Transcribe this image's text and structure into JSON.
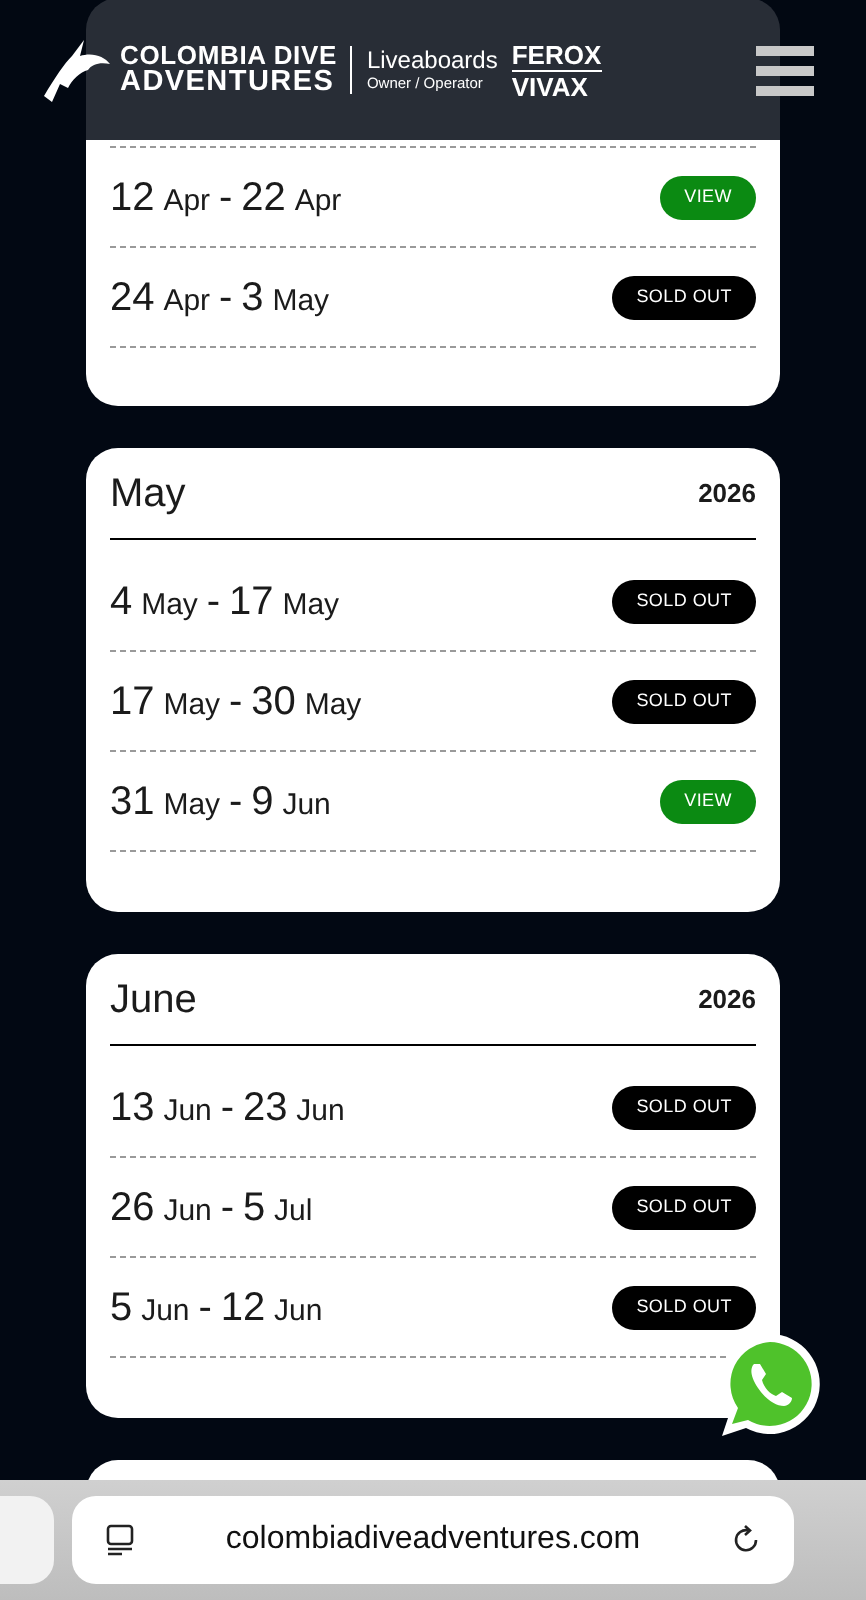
{
  "header": {
    "brand_line_1": "COLOMBIA DIVE",
    "brand_line_2": "ADVENTURES",
    "tagline_1": "Liveaboards",
    "tagline_2": "Owner / Operator",
    "boat_line_1": "FEROX",
    "boat_line_2": "VIVAX"
  },
  "months": [
    {
      "trips": [
        {
          "start_day": "12",
          "start_month": "Apr",
          "separator": "-",
          "end_day": "22",
          "end_month": "Apr",
          "status": {
            "kind": "view",
            "label": "VIEW"
          }
        },
        {
          "start_day": "24",
          "start_month": "Apr",
          "separator": "-",
          "end_day": "3",
          "end_month": "May",
          "status": {
            "kind": "sold_out",
            "label": "SOLD OUT"
          }
        }
      ]
    },
    {
      "name": "May",
      "year": "2026",
      "trips": [
        {
          "start_day": "4",
          "start_month": "May",
          "separator": "-",
          "end_day": "17",
          "end_month": "May",
          "status": {
            "kind": "sold_out",
            "label": "SOLD OUT"
          }
        },
        {
          "start_day": "17",
          "start_month": "May",
          "separator": "-",
          "end_day": "30",
          "end_month": "May",
          "status": {
            "kind": "sold_out",
            "label": "SOLD OUT"
          }
        },
        {
          "start_day": "31",
          "start_month": "May",
          "separator": "-",
          "end_day": "9",
          "end_month": "Jun",
          "status": {
            "kind": "view",
            "label": "VIEW"
          }
        }
      ]
    },
    {
      "name": "June",
      "year": "2026",
      "trips": [
        {
          "start_day": "13",
          "start_month": "Jun",
          "separator": "-",
          "end_day": "23",
          "end_month": "Jun",
          "status": {
            "kind": "sold_out",
            "label": "SOLD OUT"
          }
        },
        {
          "start_day": "26",
          "start_month": "Jun",
          "separator": "-",
          "end_day": "5",
          "end_month": "Jul",
          "status": {
            "kind": "sold_out",
            "label": "SOLD OUT"
          }
        },
        {
          "start_day": "5",
          "start_month": "Jun",
          "separator": "-",
          "end_day": "12",
          "end_month": "Jun",
          "status": {
            "kind": "sold_out",
            "label": "SOLD OUT"
          }
        }
      ]
    }
  ],
  "next_card_peek": true,
  "browser": {
    "url": "colombiadiveadventures.com"
  }
}
